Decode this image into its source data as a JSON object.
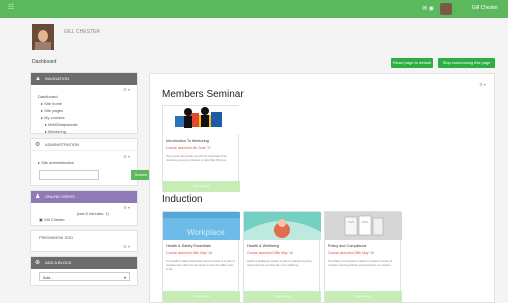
{
  "header": {
    "logo_text": "☷",
    "icons": "✉ ◉",
    "user_name": "Gill Chester"
  },
  "profile": {
    "name": "GILL CHESTER",
    "breadcrumb": "Dashboard"
  },
  "buttons": {
    "reset_label": "Reset page to default",
    "stop_label": "Stop customising this page"
  },
  "navigation": {
    "title": "NAVIGATION",
    "items": [
      "Dashboard",
      "Site home",
      "Site pages",
      "My courses",
      "MINDMapsionist",
      "Mentoring"
    ]
  },
  "administration": {
    "title": "ADMINISTRATION",
    "items": [
      "Site administration"
    ],
    "search_label": "Search"
  },
  "online_users": {
    "title": "ONLINE USERS",
    "subtitle": "(last 5 minutes: 1)",
    "user": "Gill Chester"
  },
  "freshdesk": {
    "title": "FRESHDESK SSO"
  },
  "add_block": {
    "title": "ADD A BLOCK",
    "select_value": "Add..."
  },
  "main": {
    "members_title": "Members Seminar",
    "induction_title": "Induction",
    "members_card": {
      "title": "Introduction To Mentoring",
      "meta": "Course launched 4th June '17",
      "text": "This course will provide you with the essentials of the mentoring process in Mentors to Little Miss Princess.",
      "button": "View course"
    },
    "cards": [
      {
        "title": "Health & Safety Essentials",
        "meta": "Course launched 28th May '16",
        "text": "The Health & Safety Essentials course consists of a suite of modules that outline the key areas to meet the HSE's rules in the...",
        "button": "View course",
        "image_text": "Workplace"
      },
      {
        "title": "Health & Wellbeing",
        "meta": "Course launched 28th May '16",
        "text": "Health & Wellbeing consists a suite of modules covering topics that help you look after your wellbeing...",
        "button": "View course"
      },
      {
        "title": "Policy and Compliance",
        "meta": "Course launched 28th May '16",
        "text": "The Policy & Compliance collection consists of suites of modules covering policies and procedures you need to...",
        "button": "View course"
      }
    ]
  },
  "colors": {
    "accent": "#5cb85c",
    "nav_header": "#6c6c6c",
    "online_users": "#8e7ab5"
  }
}
